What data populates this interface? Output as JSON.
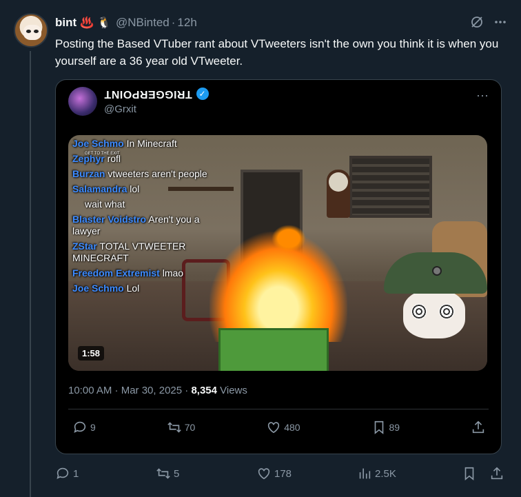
{
  "tweet": {
    "author_name": "bint",
    "author_emoji_1": "♨️",
    "author_emoji_2": "🐧",
    "handle": "@NBinted",
    "dot": "·",
    "time": "12h",
    "text": "Posting the Based VTuber rant about VTweeters isn't the own you think it is when you yourself are a 36 year old VTweeter.",
    "more_icon": "more-horizontal-icon",
    "grok_icon": "grok-icon"
  },
  "quote": {
    "author_name": "TRIGGERPOINT",
    "handle": "@Grxit",
    "verified": "✓",
    "more": "···",
    "duration": "1:58",
    "timestamp": "10:00 AM · Mar 30, 2025 · ",
    "views_count": "8,354",
    "views_label": " Views",
    "stats": {
      "replies": "9",
      "retweets": "70",
      "likes": "480",
      "bookmarks": "89"
    },
    "chat": [
      {
        "user": "Joe Schmo",
        "text": " In Minecraft"
      },
      {
        "user": "Zephyr",
        "text": " rofl"
      },
      {
        "user": "Burzan",
        "text": " vtweeters aren't people"
      },
      {
        "user": "Salamandra",
        "text": " lol"
      },
      {
        "user": "",
        "text": "wait what"
      },
      {
        "user": "Blaster Voidstro",
        "text": " Aren't you a lawyer"
      },
      {
        "user": "ZStar",
        "text": " TOTAL VTWEETER MINECRAFT"
      },
      {
        "user": "Freedom Extremist",
        "text": " lmao"
      },
      {
        "user": "Joe Schmo",
        "text": " Lol"
      }
    ],
    "chat_overlay_small": "GET TO THE EXIT"
  },
  "stats": {
    "replies": "1",
    "retweets": "5",
    "likes": "178",
    "views": "2.5K"
  },
  "colors": {
    "background": "#15202b",
    "accent": "#1d9bf0",
    "muted": "#8b98a5"
  }
}
